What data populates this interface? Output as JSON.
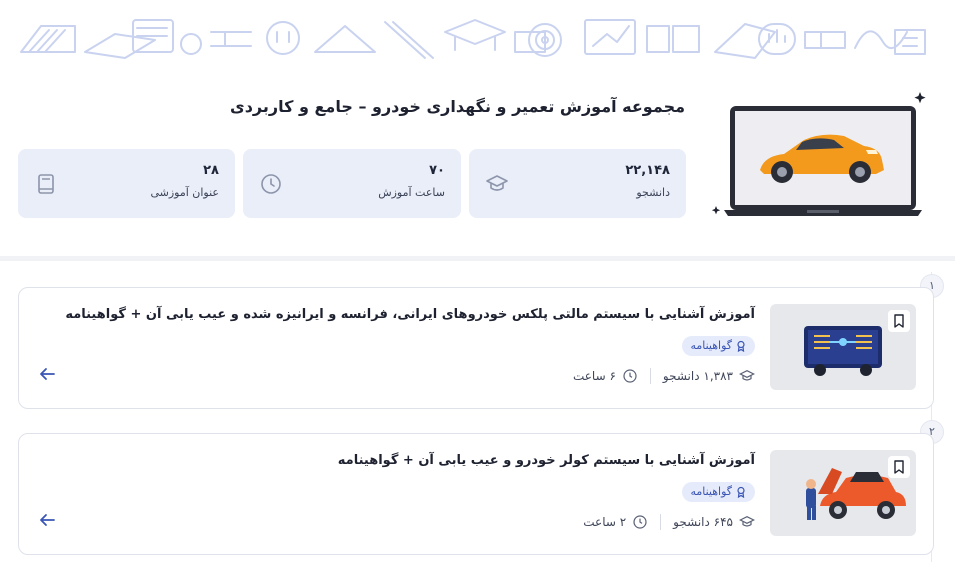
{
  "header": {
    "title": "مجموعه آموزش تعمیر و نگهداری خودرو – جامع و کاربردی"
  },
  "stats": [
    {
      "value": "۲۲,۱۴۸",
      "label": "دانشجو",
      "icon": "graduation-cap-icon"
    },
    {
      "value": "۷۰",
      "label": "ساعت آموزش",
      "icon": "clock-icon"
    },
    {
      "value": "۲۸",
      "label": "عنوان آموزشی",
      "icon": "book-icon"
    }
  ],
  "courses": [
    {
      "step": "۱",
      "title": "آموزش آشنایی با سیستم مالتی پلکس خودروهای ایرانی، فرانسه و ایرانیزه شده و عیب یابی آن + گواهینامه",
      "badge": "گواهینامه",
      "students": "۱,۳۸۳ دانشجو",
      "duration": "۶ ساعت"
    },
    {
      "step": "۲",
      "title": "آموزش آشنایی با سیستم کولر خودرو و عیب یابی آن + گواهینامه",
      "badge": "گواهینامه",
      "students": "۶۴۵ دانشجو",
      "duration": "۲ ساعت"
    }
  ],
  "colors": {
    "accent": "#3a55b4",
    "stat_bg": "#eaeef9",
    "car_orange": "#f39a1c"
  }
}
